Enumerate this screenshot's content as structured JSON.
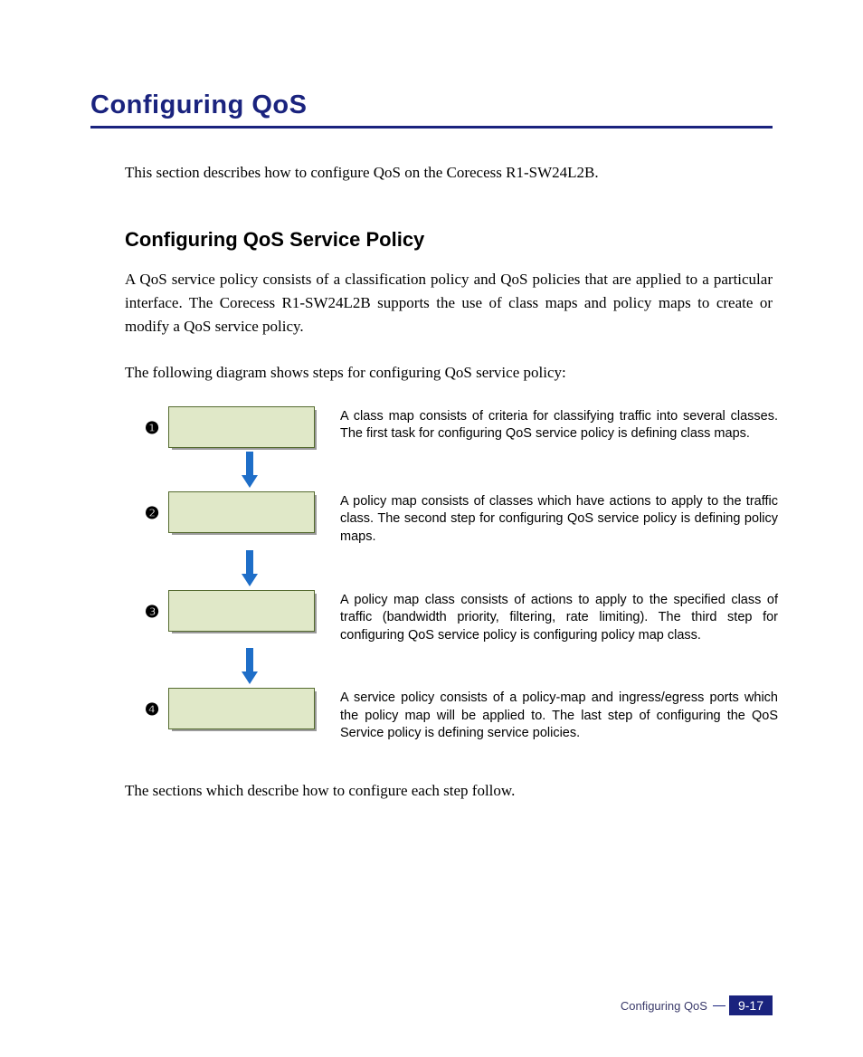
{
  "title": "Configuring QoS",
  "intro": "This section describes how to configure QoS on the Corecess R1-SW24L2B.",
  "subtitle": "Configuring QoS Service Policy",
  "para1": "A QoS service policy consists of a classification policy and QoS policies that are applied to a particular interface. The Corecess R1-SW24L2B supports the use of class maps and policy maps to create or modify a QoS service policy.",
  "para2": "The following diagram shows steps for configuring QoS service policy:",
  "steps": [
    {
      "num": "❶",
      "desc": "A class map consists of criteria for classifying traffic into several classes. The first task for configuring QoS service policy is defining class maps."
    },
    {
      "num": "❷",
      "desc": "A policy map consists of classes which have actions to apply to the traffic class. The second step for configuring QoS service policy is defining policy maps."
    },
    {
      "num": "❸",
      "desc": "A policy map class consists of actions to apply to the specified class of traffic (bandwidth priority, filtering, rate limiting). The third step for configuring QoS service policy is configuring policy map class."
    },
    {
      "num": "❹",
      "desc": "A service policy consists of a policy-map and ingress/egress ports which the policy map will be applied to. The last step of configuring the QoS Service policy is defining service policies."
    }
  ],
  "closing": "The sections which describe how to configure each step follow.",
  "footer": {
    "label": "Configuring QoS",
    "page": "9-17"
  }
}
